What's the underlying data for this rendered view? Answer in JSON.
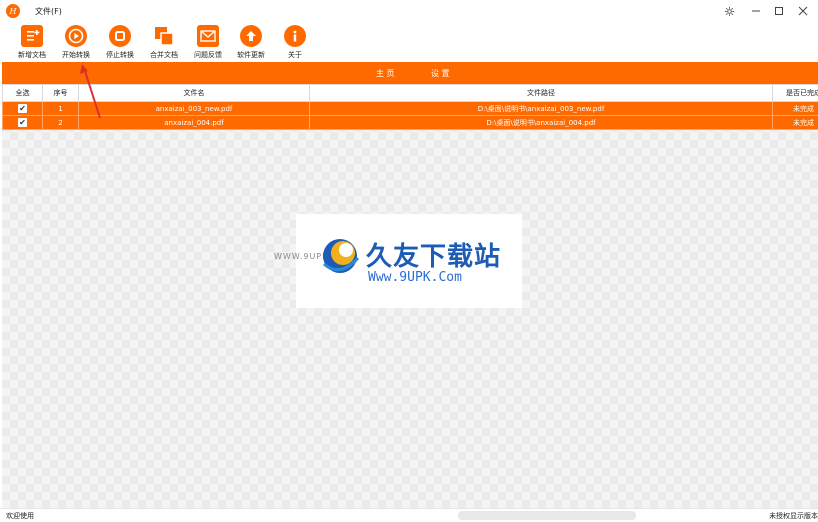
{
  "titlebar": {
    "menu_file": "文件(F)",
    "logo_letter": "H"
  },
  "toolbar": {
    "buttons": [
      {
        "label": "新增文档",
        "icon": "add-document-icon"
      },
      {
        "label": "开始转换",
        "icon": "play-icon"
      },
      {
        "label": "停止转换",
        "icon": "stop-icon"
      },
      {
        "label": "合并文档",
        "icon": "merge-icon"
      },
      {
        "label": "问题反馈",
        "icon": "mail-icon"
      },
      {
        "label": "软件更新",
        "icon": "upload-arrow-icon"
      },
      {
        "label": "关于",
        "icon": "info-icon"
      }
    ]
  },
  "tabs": {
    "first": "主 页",
    "second": "设 置"
  },
  "table": {
    "headers": [
      "全选",
      "序号",
      "文件名",
      "文件路径",
      "是否已完成"
    ],
    "rows": [
      {
        "checked": true,
        "index": "1",
        "filename": "anxaizai_003_new.pdf",
        "path": "D:\\桌面\\说明书\\anxaizai_003_new.pdf",
        "status": "未完成"
      },
      {
        "checked": true,
        "index": "2",
        "filename": "anxaizai_004.pdf",
        "path": "D:\\桌面\\说明书\\anxaizai_004.pdf",
        "status": "未完成"
      }
    ]
  },
  "watermark": {
    "small_url": "WWW.9UPK.COM",
    "title": "久友下载站",
    "url": "Www.9UPK.Com"
  },
  "statusbar": {
    "left": "欢迎使用",
    "right": "未授权显示版本"
  },
  "colors": {
    "accent": "#ff6a00",
    "watermark_blue": "#1d5bb5",
    "arrow": "#d9302c"
  }
}
